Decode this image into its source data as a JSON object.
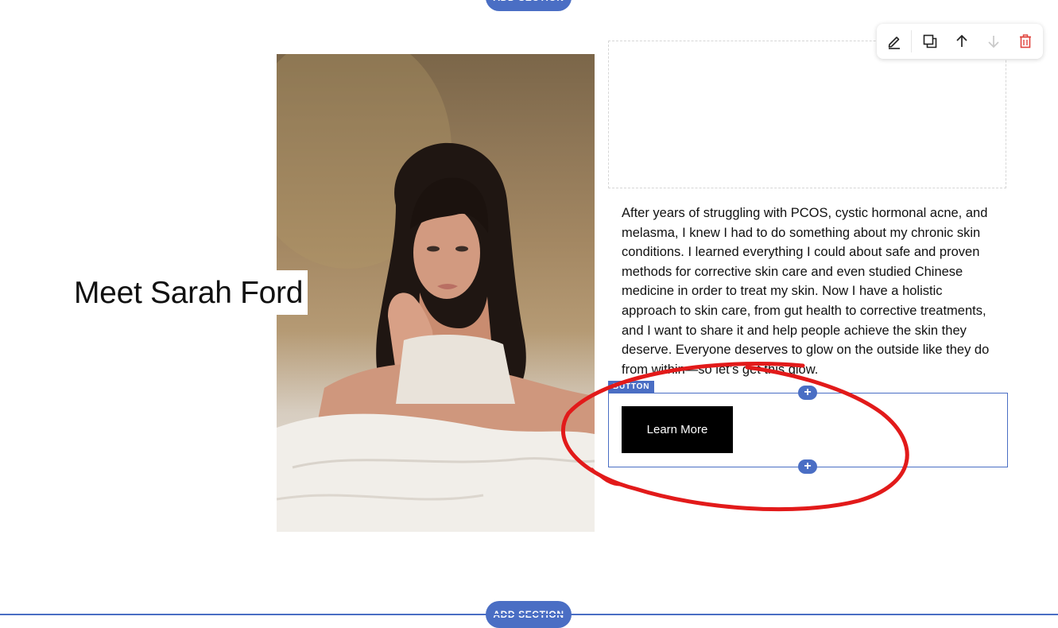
{
  "editor": {
    "add_section_top_label": "ADD SECTION",
    "add_section_bottom_label": "ADD SECTION",
    "accent_color": "#4a6ec4",
    "toolbar": {
      "icons": [
        "edit-icon",
        "duplicate-icon",
        "move-up-icon",
        "move-down-icon",
        "delete-icon"
      ],
      "delete_color": "#e0443e"
    },
    "selected_block_label": "BUTTON"
  },
  "section": {
    "title": "Meet Sarah Ford",
    "bio": "After years of struggling with PCOS, cystic hormonal acne, and melasma, I knew I had to do something about my chronic skin conditions. I learned everything I could about safe and proven methods for corrective skin care and even studied Chinese medicine in order to treat my skin. Now I have a holistic approach to skin care, from gut health to corrective treatments, and I want to share it and help people achieve the skin they deserve. Everyone deserves to glow on the outside like they do from within—so let’s get this glow.",
    "button_label": "Learn More",
    "button_color": "#000000"
  },
  "annotation": {
    "color": "#e21a1a",
    "shape": "hand-drawn ellipse around the button block"
  }
}
